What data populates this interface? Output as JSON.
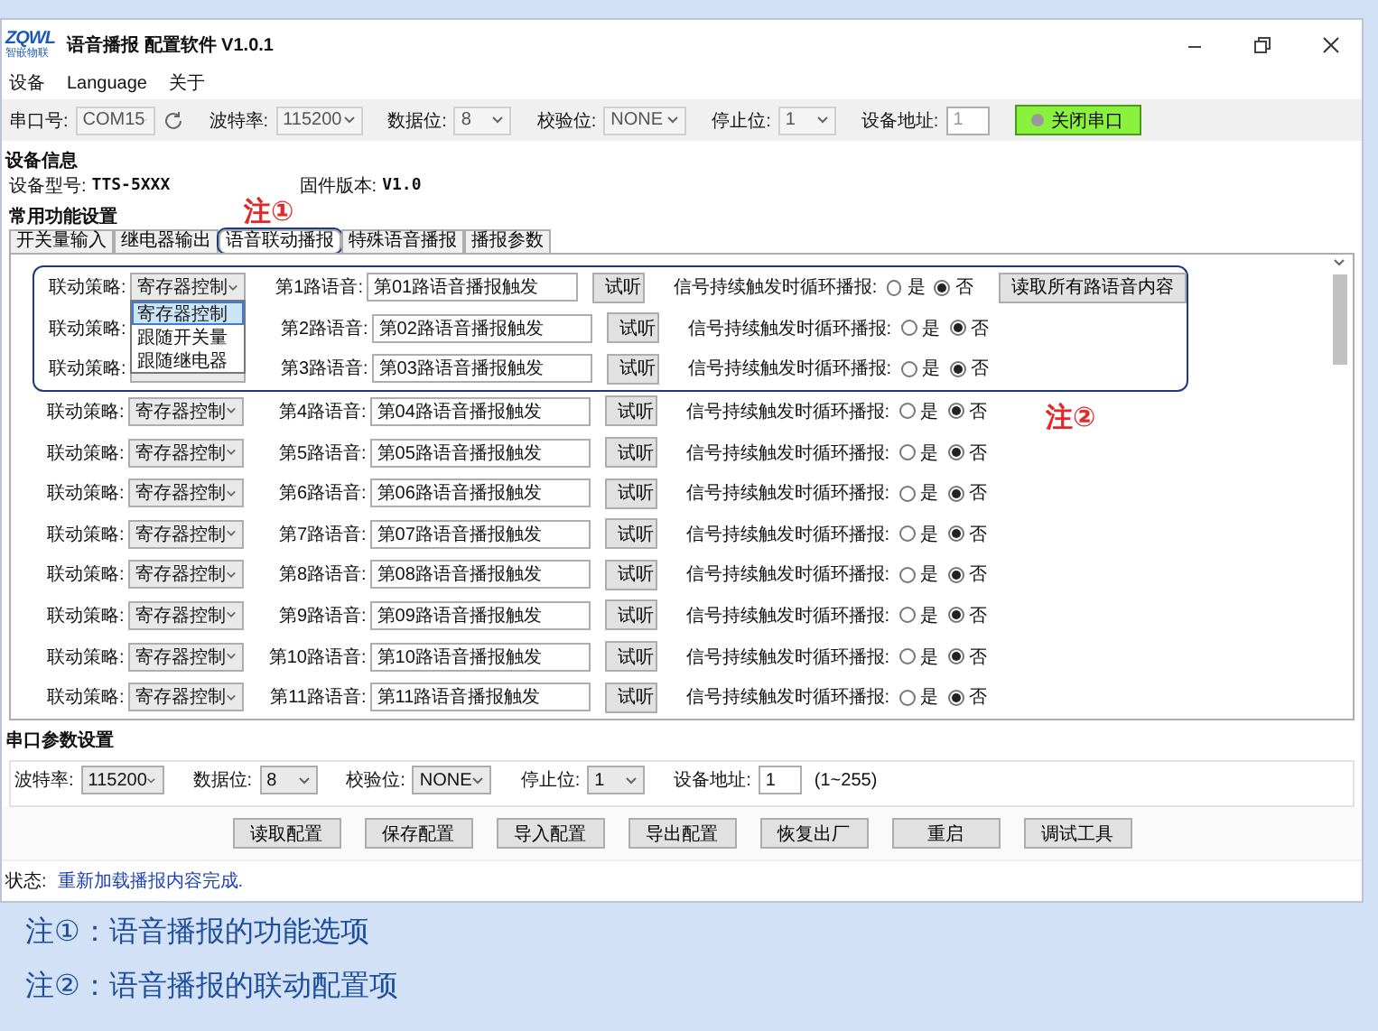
{
  "window": {
    "title": "语音播报 配置软件 V1.0.1",
    "logo": "ZQWL",
    "logo_sub": "智嵌物联"
  },
  "menu": [
    "设备",
    "Language",
    "关于"
  ],
  "toolbar": {
    "fields": [
      {
        "label": "串口号:",
        "value": "COM15",
        "kind": "select",
        "disabled": true,
        "refresh": true
      },
      {
        "label": "波特率:",
        "value": "115200",
        "kind": "select",
        "disabled": true
      },
      {
        "label": "数据位:",
        "value": "8",
        "kind": "select",
        "disabled": true
      },
      {
        "label": "校验位:",
        "value": "NONE",
        "kind": "select",
        "disabled": true
      },
      {
        "label": "停止位:",
        "value": "1",
        "kind": "select",
        "disabled": true
      },
      {
        "label": "设备地址:",
        "value": "1",
        "kind": "input",
        "disabled": true
      }
    ],
    "connect_button": {
      "label": "关闭串口",
      "connected": true
    }
  },
  "device_info": {
    "heading": "设备信息",
    "model_label": "设备型号:",
    "model": "TTS-5XXX",
    "firmware_label": "固件版本:",
    "firmware": "V1.0"
  },
  "functions": {
    "heading": "常用功能设置",
    "tabs": [
      {
        "label": "开关量输入",
        "selected": false,
        "circled": false
      },
      {
        "label": "继电器输出",
        "selected": false,
        "circled": false
      },
      {
        "label": "语音联动播报",
        "selected": true,
        "circled": true,
        "note": "注①"
      },
      {
        "label": "特殊语音播报",
        "selected": false,
        "circled": false
      },
      {
        "label": "播报参数",
        "selected": false,
        "circled": false
      }
    ],
    "circled_note": "注②",
    "read_all_button": "读取所有路语音内容",
    "rows": [
      {
        "strategy_label": "联动策略:",
        "strategy": "寄存器控制",
        "voice_label": "第1路语音:",
        "voice": "第01路语音播报触发",
        "listen": "试听",
        "loop_label": "信号持续触发时循环播报:",
        "options": [
          {
            "label": "是",
            "selected": false
          },
          {
            "label": "否",
            "selected": true
          }
        ],
        "circled": true,
        "dropdown": [
          {
            "label": "寄存器控制",
            "selected": true
          },
          {
            "label": "跟随开关量",
            "selected": false
          },
          {
            "label": "跟随继电器",
            "selected": false
          }
        ]
      },
      {
        "strategy_label": "联动策略:",
        "voice_label": "第2路语音:",
        "voice": "第02路语音播报触发",
        "listen": "试听",
        "loop_label": "信号持续触发时循环播报:",
        "options": [
          {
            "label": "是",
            "selected": false
          },
          {
            "label": "否",
            "selected": true
          }
        ],
        "circled": true
      },
      {
        "strategy_label": "联动策略:",
        "voice_label": "第3路语音:",
        "voice": "第03路语音播报触发",
        "listen": "试听",
        "loop_label": "信号持续触发时循环播报:",
        "options": [
          {
            "label": "是",
            "selected": false
          },
          {
            "label": "否",
            "selected": true
          }
        ],
        "circled": true
      },
      {
        "strategy_label": "联动策略:",
        "strategy": "寄存器控制",
        "voice_label": "第4路语音:",
        "voice": "第04路语音播报触发",
        "listen": "试听",
        "loop_label": "信号持续触发时循环播报:",
        "options": [
          {
            "label": "是",
            "selected": false
          },
          {
            "label": "否",
            "selected": true
          }
        ],
        "circled": false
      },
      {
        "strategy_label": "联动策略:",
        "strategy": "寄存器控制",
        "voice_label": "第5路语音:",
        "voice": "第05路语音播报触发",
        "listen": "试听",
        "loop_label": "信号持续触发时循环播报:",
        "options": [
          {
            "label": "是",
            "selected": false
          },
          {
            "label": "否",
            "selected": true
          }
        ],
        "circled": false
      },
      {
        "strategy_label": "联动策略:",
        "strategy": "寄存器控制",
        "voice_label": "第6路语音:",
        "voice": "第06路语音播报触发",
        "listen": "试听",
        "loop_label": "信号持续触发时循环播报:",
        "options": [
          {
            "label": "是",
            "selected": false
          },
          {
            "label": "否",
            "selected": true
          }
        ],
        "circled": false
      },
      {
        "strategy_label": "联动策略:",
        "strategy": "寄存器控制",
        "voice_label": "第7路语音:",
        "voice": "第07路语音播报触发",
        "listen": "试听",
        "loop_label": "信号持续触发时循环播报:",
        "options": [
          {
            "label": "是",
            "selected": false
          },
          {
            "label": "否",
            "selected": true
          }
        ],
        "circled": false
      },
      {
        "strategy_label": "联动策略:",
        "strategy": "寄存器控制",
        "voice_label": "第8路语音:",
        "voice": "第08路语音播报触发",
        "listen": "试听",
        "loop_label": "信号持续触发时循环播报:",
        "options": [
          {
            "label": "是",
            "selected": false
          },
          {
            "label": "否",
            "selected": true
          }
        ],
        "circled": false
      },
      {
        "strategy_label": "联动策略:",
        "strategy": "寄存器控制",
        "voice_label": "第9路语音:",
        "voice": "第09路语音播报触发",
        "listen": "试听",
        "loop_label": "信号持续触发时循环播报:",
        "options": [
          {
            "label": "是",
            "selected": false
          },
          {
            "label": "否",
            "selected": true
          }
        ],
        "circled": false
      },
      {
        "strategy_label": "联动策略:",
        "strategy": "寄存器控制",
        "voice_label": "第10路语音:",
        "voice": "第10路语音播报触发",
        "listen": "试听",
        "loop_label": "信号持续触发时循环播报:",
        "options": [
          {
            "label": "是",
            "selected": false
          },
          {
            "label": "否",
            "selected": true
          }
        ],
        "circled": false
      },
      {
        "strategy_label": "联动策略:",
        "strategy": "寄存器控制",
        "voice_label": "第11路语音:",
        "voice": "第11路语音播报触发",
        "listen": "试听",
        "loop_label": "信号持续触发时循环播报:",
        "options": [
          {
            "label": "是",
            "selected": false
          },
          {
            "label": "否",
            "selected": true
          }
        ],
        "circled": false
      }
    ]
  },
  "serial": {
    "heading": "串口参数设置",
    "fields": [
      {
        "label": "波特率:",
        "value": "115200",
        "kind": "select",
        "disabled": false
      },
      {
        "label": "数据位:",
        "value": "8",
        "kind": "select",
        "disabled": false
      },
      {
        "label": "校验位:",
        "value": "NONE",
        "kind": "select",
        "disabled": false
      },
      {
        "label": "停止位:",
        "value": "1",
        "kind": "select",
        "disabled": false
      },
      {
        "label": "设备地址:",
        "value": "1",
        "kind": "input",
        "disabled": false
      }
    ],
    "range": "(1~255)"
  },
  "actions": [
    "读取配置",
    "保存配置",
    "导入配置",
    "导出配置",
    "恢复出厂",
    "重启",
    "调试工具"
  ],
  "status": {
    "label": "状态:",
    "message": "重新加载播报内容完成."
  },
  "notes": [
    "注①：语音播报的功能选项",
    "注②：语音播报的联动配置项"
  ]
}
